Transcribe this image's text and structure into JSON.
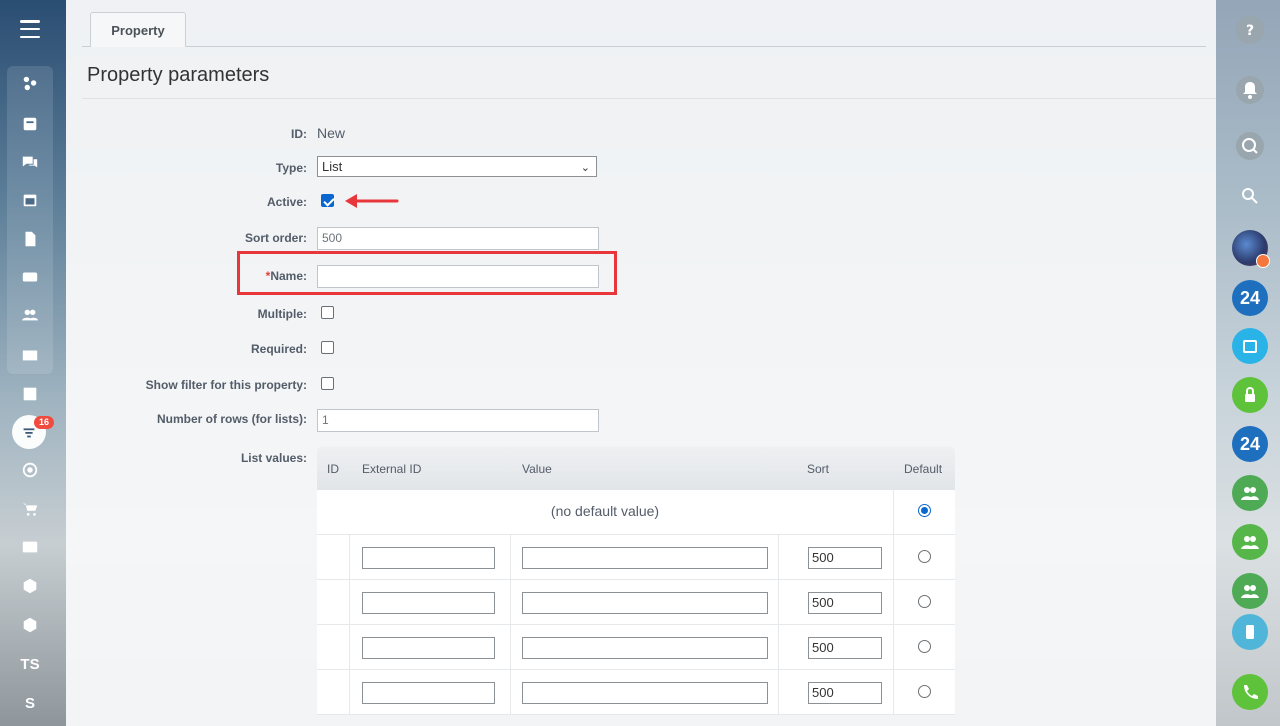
{
  "tabs": [
    {
      "label": "Property"
    }
  ],
  "page_title": "Property parameters",
  "sidebar": {
    "badge_count": "16",
    "text_items": [
      "TS",
      "S"
    ]
  },
  "form": {
    "id_label": "ID:",
    "id_value": "New",
    "type_label": "Type:",
    "type_value": "List",
    "active_label": "Active:",
    "active_checked": true,
    "sort_label": "Sort order:",
    "sort_value": "500",
    "name_required_mark": "*",
    "name_label": "Name:",
    "name_value": "",
    "multiple_label": "Multiple:",
    "required_label": "Required:",
    "filter_label": "Show filter for this property:",
    "rows_label": "Number of rows (for lists):",
    "rows_value": "1",
    "list_values_label": "List values:"
  },
  "list_table": {
    "headers": {
      "id": "ID",
      "external_id": "External ID",
      "value": "Value",
      "sort": "Sort",
      "default": "Default"
    },
    "no_default_label": "(no default value)",
    "rows": [
      {
        "external_id": "",
        "value": "",
        "sort": "500"
      },
      {
        "external_id": "",
        "value": "",
        "sort": "500"
      },
      {
        "external_id": "",
        "value": "",
        "sort": "500"
      },
      {
        "external_id": "",
        "value": "",
        "sort": "500"
      }
    ]
  },
  "rightbar": {
    "badge_24": "24"
  },
  "colors": {
    "accent": "#0b67d0",
    "highlight": "#e8363b"
  }
}
